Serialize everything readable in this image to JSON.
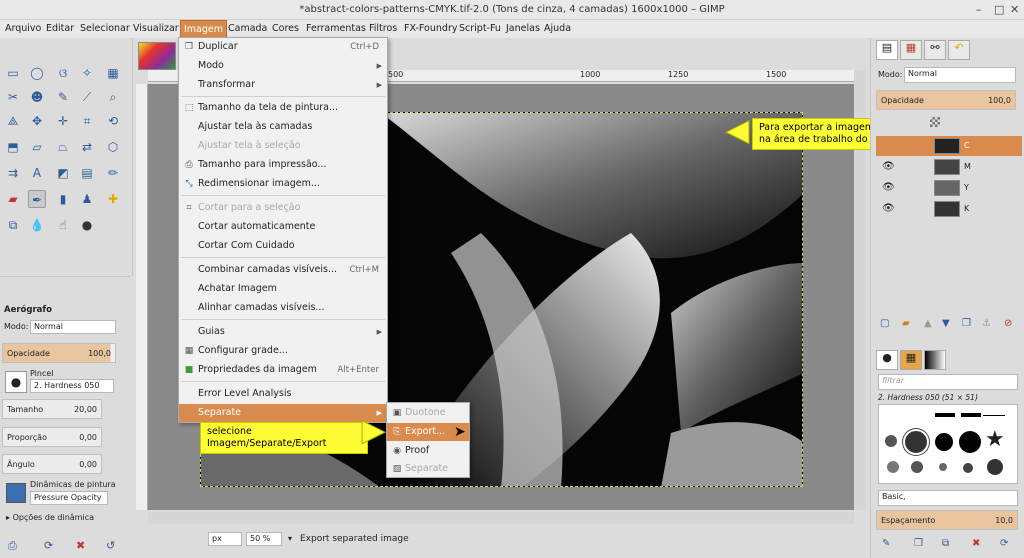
{
  "window": {
    "title": "*abstract-colors-patterns-CMYK.tif-2.0 (Tons de cinza, 4 camadas) 1600x1000 – GIMP",
    "controls": [
      "–",
      "□",
      "✕"
    ]
  },
  "menubar": [
    "Arquivo",
    "Editar",
    "Selecionar",
    "Visualizar",
    "Imagem",
    "Camada",
    "Cores",
    "Ferramentas",
    "Filtros",
    "FX-Foundry",
    "Script-Fu",
    "Janelas",
    "Ajuda"
  ],
  "menubar_active": "Imagem",
  "image_menu": {
    "duplicar": {
      "label": "Duplicar",
      "shortcut": "Ctrl+D"
    },
    "modo": {
      "label": "Modo"
    },
    "transformar": {
      "label": "Transformar"
    },
    "tamanho_tela": {
      "label": "Tamanho da tela de pintura..."
    },
    "ajustar_camadas": {
      "label": "Ajustar tela às camadas"
    },
    "ajustar_selecao": {
      "label": "Ajustar tela à seleção"
    },
    "tamanho_impressao": {
      "label": "Tamanho para impressão..."
    },
    "redimensionar": {
      "label": "Redimensionar imagem..."
    },
    "cortar_selecao": {
      "label": "Cortar para a seleção"
    },
    "cortar_auto": {
      "label": "Cortar automaticamente"
    },
    "cortar_cuidado": {
      "label": "Cortar Com Cuidado"
    },
    "combinar": {
      "label": "Combinar camadas visíveis...",
      "shortcut": "Ctrl+M"
    },
    "achatar": {
      "label": "Achatar Imagem"
    },
    "alinhar": {
      "label": "Alinhar camadas visíveis..."
    },
    "guias": {
      "label": "Guias"
    },
    "grade": {
      "label": "Configurar grade..."
    },
    "propriedades": {
      "label": "Propriedades da imagem",
      "shortcut": "Alt+Enter"
    },
    "ela": {
      "label": "Error Level Analysis"
    },
    "separate": {
      "label": "Separate"
    }
  },
  "separate_submenu": {
    "duotone": "Duotone",
    "export": "Export...",
    "proof": "Proof",
    "separate": "Separate"
  },
  "callouts": {
    "right_line1": "Para exportar a imagem volte.",
    "right_line2": "na área de trabalho do CMYK.",
    "left": "selecione Imagem/Separate/Export"
  },
  "tool_options": {
    "title": "Aerógrafo",
    "mode_label": "Modo:",
    "mode_value": "Normal",
    "opacity_label": "Opacidade",
    "opacity_value": "100,0",
    "brush_label": "Pincel",
    "brush_value": "2. Hardness 050",
    "size_label": "Tamanho",
    "size_value": "20,00",
    "ratio_label": "Proporção",
    "ratio_value": "0,00",
    "angle_label": "Ângulo",
    "angle_value": "0,00",
    "dynamics_label": "Dinâmicas de pintura",
    "dynamics_value": "Pressure Opacity",
    "dynamics_options": "Opções de dinâmica"
  },
  "ruler": {
    "ticks": [
      "500",
      "1000",
      "1250",
      "1500"
    ]
  },
  "statusbar": {
    "unit": "px",
    "zoom": "50 %",
    "message": "Export separated image"
  },
  "layers_panel": {
    "mode_label": "Modo:",
    "mode_value": "Normal",
    "opacity_label": "Opacidade",
    "opacity_value": "100,0",
    "layers": [
      {
        "name": "C",
        "active": true
      },
      {
        "name": "M",
        "active": false
      },
      {
        "name": "Y",
        "active": false
      },
      {
        "name": "K",
        "active": false
      }
    ]
  },
  "brushes_panel": {
    "filter_placeholder": "filtrar",
    "brush_name": "2. Hardness 050 (51 × 51)",
    "preset": "Basic,",
    "spacing_label": "Espaçamento",
    "spacing_value": "10,0"
  },
  "colors": {
    "menu_highlight": "#d98b4d",
    "callout": "#fdfd36",
    "opacity_fill": "#e8c49f"
  }
}
